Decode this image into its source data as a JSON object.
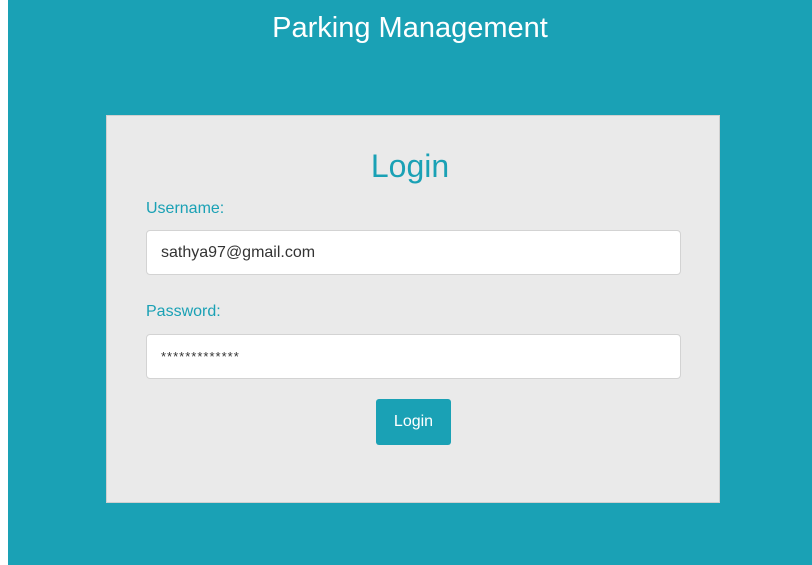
{
  "header": {
    "title": "Parking Management"
  },
  "login_card": {
    "title": "Login",
    "username": {
      "label": "Username:",
      "value": "sathya97@gmail.com"
    },
    "password": {
      "label": "Password:",
      "value": "*************"
    },
    "submit_label": "Login"
  },
  "colors": {
    "accent": "#1aa1b5",
    "card_background": "#eaeaea",
    "input_background": "#ffffff"
  }
}
